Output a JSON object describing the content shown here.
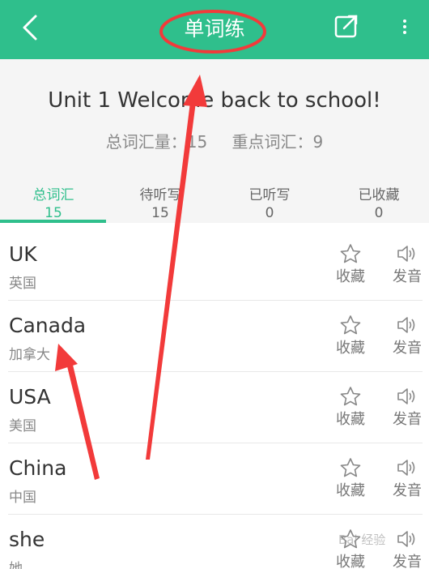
{
  "appbar": {
    "title": "单词练"
  },
  "summary": {
    "unit_title": "Unit 1 Welcome back to school!",
    "total_label": "总词汇量：15",
    "key_label": "重点词汇：9"
  },
  "tabs": [
    {
      "label": "总词汇",
      "count": "15"
    },
    {
      "label": "待听写",
      "count": "15"
    },
    {
      "label": "已听写",
      "count": "0"
    },
    {
      "label": "已收藏",
      "count": "0"
    }
  ],
  "words": [
    {
      "word": "UK",
      "meaning": "英国"
    },
    {
      "word": "Canada",
      "meaning": "加拿大"
    },
    {
      "word": "USA",
      "meaning": "美国"
    },
    {
      "word": "China",
      "meaning": "中国"
    },
    {
      "word": "she",
      "meaning": "她"
    }
  ],
  "actions": {
    "favorite_label": "收藏",
    "sound_label": "发音"
  },
  "watermark": "Bai 经验",
  "colors": {
    "accent": "#2fbf8c",
    "annotation": "#f23a3a"
  }
}
